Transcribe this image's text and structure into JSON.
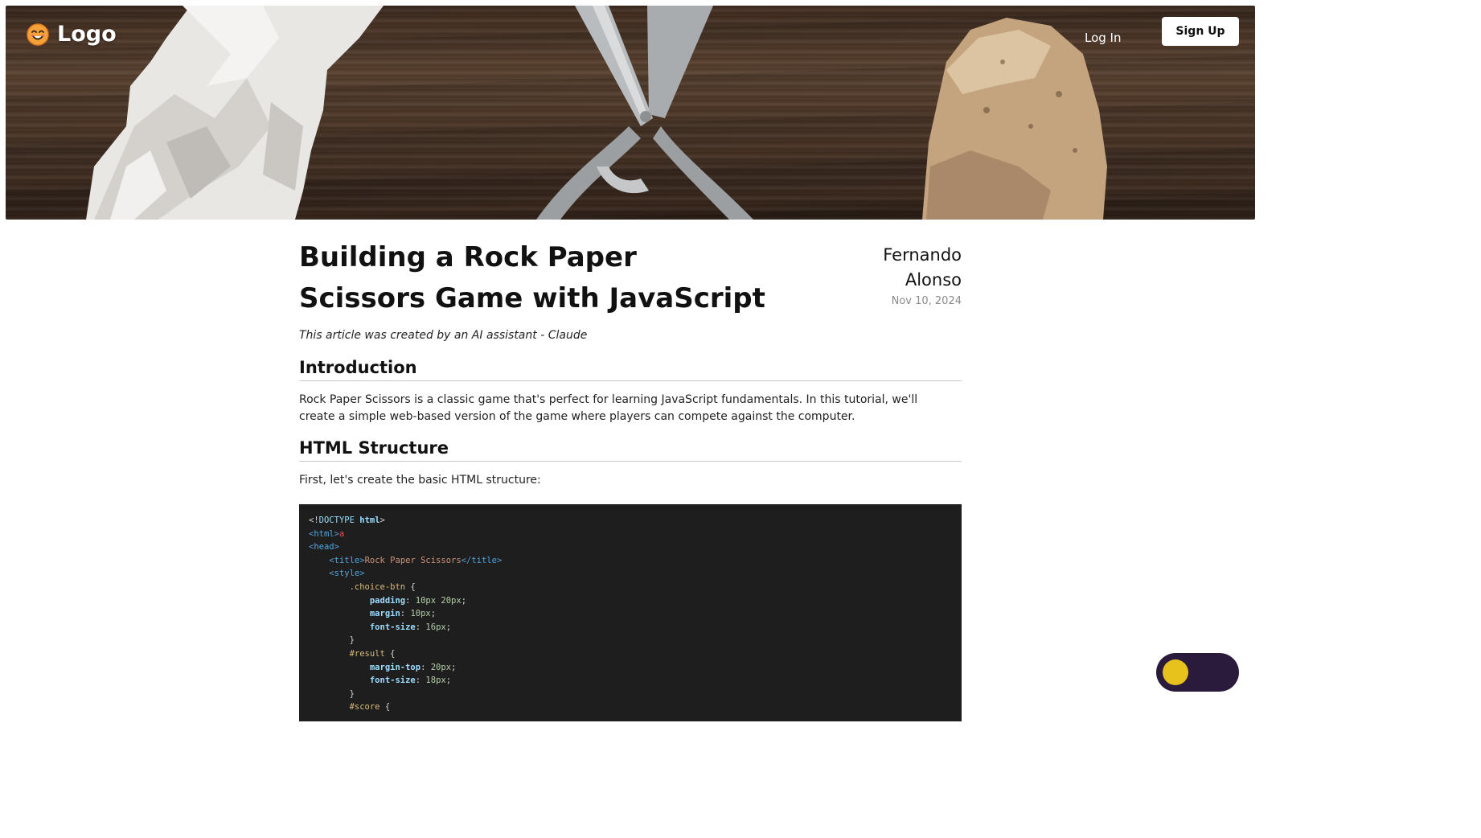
{
  "header": {
    "logo_text": "Logo",
    "logo_icon": "smiley-face-icon",
    "login_label": "Log In",
    "signup_label": "Sign Up",
    "hero_image": "rock-paper-scissors-banner"
  },
  "article": {
    "title": "Building a Rock Paper Scissors Game with JavaScript",
    "author": "Fernando Alonso",
    "date": "Nov 10, 2024",
    "ai_note": "This article was created by an AI assistant - Claude",
    "sections": [
      {
        "heading": "Introduction",
        "body": "Rock Paper Scissors is a classic game that's perfect for learning JavaScript fundamentals. In this tutorial, we'll create a simple web-based version of the game where players can compete against the computer."
      },
      {
        "heading": "HTML Structure",
        "body": "First, let's create the basic HTML structure:"
      }
    ],
    "code_lines": [
      "<!DOCTYPE html>",
      "<html>a",
      "<head>",
      "    <title>Rock Paper Scissors</title>",
      "    <style>",
      "        .choice-btn {",
      "            padding: 10px 20px;",
      "            margin: 10px;",
      "            font-size: 16px;",
      "        }",
      "        #result {",
      "            margin-top: 20px;",
      "            font-size: 18px;",
      "        }",
      "        #score {"
    ]
  },
  "theme_toggle": {
    "knob_color": "#e8c21c",
    "track_color": "#2a1b3d"
  }
}
